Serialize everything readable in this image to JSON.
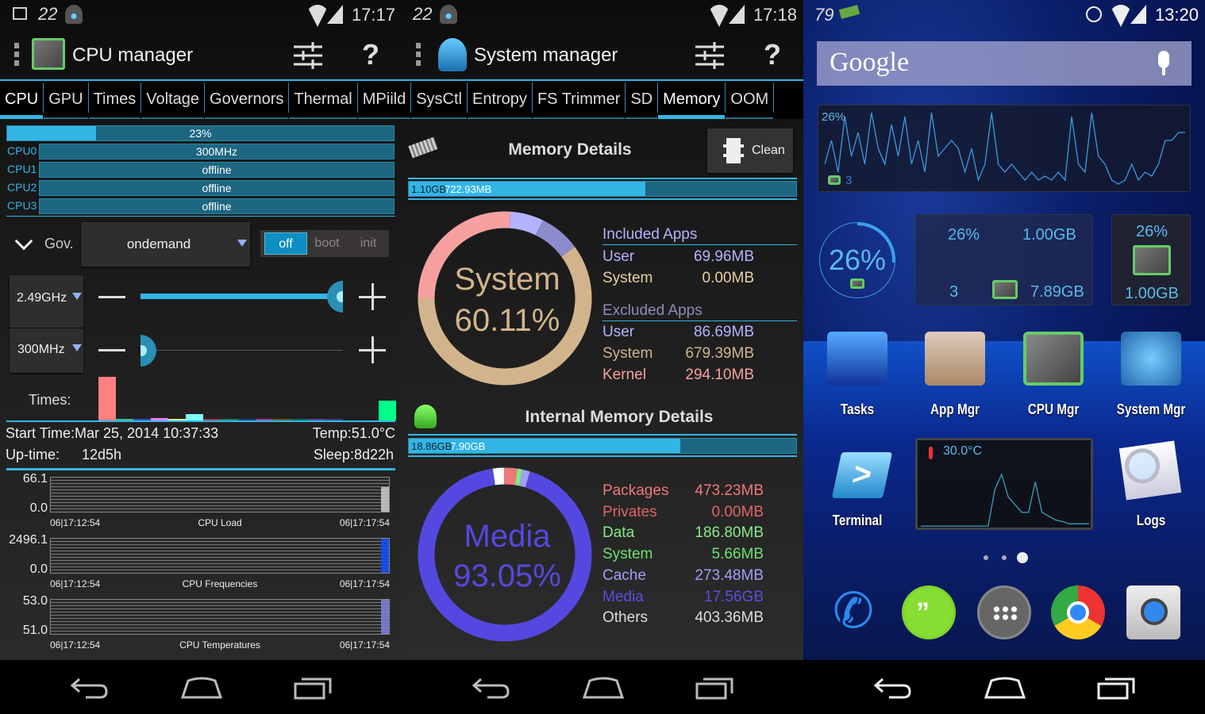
{
  "colors": {
    "accent": "#33b5e5",
    "bar_bg": "#1d6682",
    "kernel": "#f7a0a0",
    "system": "#d2b48c",
    "user_included": "#b3b3ff",
    "user_excluded": "#8c8ccc",
    "media": "#5548e0"
  },
  "cpu_manager": {
    "status": {
      "time": "17:17",
      "icons": [
        "picture-icon",
        "battery-22-icon",
        "eye-app-icon",
        "wifi-icon",
        "signal-icon"
      ],
      "battery": "22"
    },
    "title": "CPU manager",
    "actions": [
      "tune-icon",
      "help-icon"
    ],
    "help_label": "?",
    "total_load": {
      "label": "23%",
      "value": 23
    },
    "cores": [
      {
        "name": "CPU0",
        "label": "300MHz"
      },
      {
        "name": "CPU1",
        "label": "offline"
      },
      {
        "name": "CPU2",
        "label": "offline"
      },
      {
        "name": "CPU3",
        "label": "offline"
      }
    ],
    "gov_label": "Gov.",
    "governor": "ondemand",
    "apply_options": [
      "off",
      "boot",
      "init"
    ],
    "apply_selected": "off",
    "max_freq": {
      "value": "2.49GHz",
      "slider": 100
    },
    "min_freq": {
      "value": "300MHz",
      "slider": 0
    },
    "times_label": "Times:",
    "times_bars": [
      {
        "color": "#ff8080",
        "value": 100
      },
      {
        "color": "#40c080",
        "value": 2
      },
      {
        "color": "#3050c0",
        "value": 3
      },
      {
        "color": "#ff80ff",
        "value": 5
      },
      {
        "color": "#ffff80",
        "value": 4
      },
      {
        "color": "#80ffff",
        "value": 14
      },
      {
        "color": "#a04040",
        "value": 1
      },
      {
        "color": "#208060",
        "value": 1
      },
      {
        "color": "#204080",
        "value": 1
      },
      {
        "color": "#a040a0",
        "value": 1
      },
      {
        "color": "#606020",
        "value": 1
      },
      {
        "color": "#206060",
        "value": 1
      },
      {
        "color": "#6040a0",
        "value": 1
      },
      {
        "color": "#404080",
        "value": 1
      },
      {
        "color": "#00ff88",
        "value": 45
      }
    ],
    "start_time": "Start Time:Mar 25, 2014 10:37:33",
    "temp": "Temp:51.0°C",
    "uptime_label": "Up-time:",
    "uptime": "12d5h",
    "sleep": "Sleep:8d22h",
    "graphs": [
      {
        "title": "CPU Load",
        "max": "66.1",
        "min": "0.0",
        "start": "06|17:12:54",
        "end": "06|17:17:54",
        "color": "#cccccc"
      },
      {
        "title": "CPU Frequencies",
        "max": "2496.1",
        "min": "0.0",
        "start": "06|17:12:54",
        "end": "06|17:17:54",
        "color": "#1050ff"
      },
      {
        "title": "CPU Temperatures",
        "max": "53.0",
        "min": "51.0",
        "start": "06|17:12:54",
        "end": "06|17:17:54",
        "color": "#8080e0"
      }
    ]
  },
  "tabs": [
    {
      "label": "CPU",
      "selected": true
    },
    {
      "label": "GPU"
    },
    {
      "label": "Times"
    },
    {
      "label": "Voltage"
    },
    {
      "label": "Governors"
    },
    {
      "label": "Thermal"
    },
    {
      "label": "MPiild"
    },
    {
      "label": "SysCtl"
    },
    {
      "label": "Entropy"
    },
    {
      "label": "FS Trimmer"
    },
    {
      "label": "SD"
    },
    {
      "label": "Memory",
      "selected": true
    },
    {
      "label": "OOM"
    }
  ],
  "system_manager": {
    "status": {
      "time": "17:18",
      "battery": "22"
    },
    "title": "System manager",
    "help_label": "?",
    "memory": {
      "title": "Memory Details",
      "clean_label": "Clean",
      "used": "1.10GB",
      "free": "722.93MB",
      "used_fraction": 0.61,
      "donut_label": "System",
      "donut_value": "60.11%",
      "included_title": "Included Apps",
      "included": [
        {
          "label": "User",
          "value": "69.96MB",
          "color": "#b3b3ff"
        },
        {
          "label": "System",
          "value": "0.00MB",
          "color": "#e8cfa0"
        }
      ],
      "excluded_title": "Excluded Apps",
      "excluded": [
        {
          "label": "User",
          "value": "86.69MB",
          "color": "#b3b3ff"
        },
        {
          "label": "System",
          "value": "679.39MB",
          "color": "#d2b48c"
        },
        {
          "label": "Kernel",
          "value": "294.10MB",
          "color": "#f7a0a0"
        }
      ],
      "segments": [
        {
          "name": "Kernel",
          "mb": 294.1,
          "color": "#f7a0a0"
        },
        {
          "name": "User (included)",
          "mb": 69.96,
          "color": "#b3b3ff"
        },
        {
          "name": "User (excluded)",
          "mb": 86.69,
          "color": "#8c8ccc"
        },
        {
          "name": "System",
          "mb": 679.39,
          "color": "#d2b48c"
        }
      ]
    },
    "internal": {
      "title": "Internal Memory Details",
      "used": "18.86GB",
      "free": "7.90GB",
      "used_fraction": 0.7,
      "donut_label": "Media",
      "donut_value": "93.05%",
      "items": [
        {
          "label": "Packages",
          "value": "473.23MB",
          "color": "#f07878"
        },
        {
          "label": "Privates",
          "value": "0.00MB",
          "color": "#e06464"
        },
        {
          "label": "Data",
          "value": "186.80MB",
          "color": "#88e888"
        },
        {
          "label": "System",
          "value": "5.66MB",
          "color": "#70e070"
        },
        {
          "label": "Cache",
          "value": "273.48MB",
          "color": "#a0a0f5"
        },
        {
          "label": "Media",
          "value": "17.56GB",
          "color": "#5a4ee0"
        },
        {
          "label": "Others",
          "value": "403.36MB",
          "color": "#dddddd"
        }
      ],
      "segments": [
        {
          "name": "Others",
          "mb": 403.36,
          "color": "#ffffff"
        },
        {
          "name": "Packages",
          "mb": 473.23,
          "color": "#f07878"
        },
        {
          "name": "Data",
          "mb": 186.8,
          "color": "#88e888"
        },
        {
          "name": "Cache",
          "mb": 273.48,
          "color": "#a0a0f5"
        },
        {
          "name": "Media",
          "mb": 17981.44,
          "color": "#5548e0"
        }
      ]
    }
  },
  "home": {
    "status": {
      "left": "79",
      "time": "13:20"
    },
    "search_logo": "Google",
    "graph_widget": {
      "load": "26%",
      "cores": "3"
    },
    "circle_widget": {
      "load": "26%",
      "value": 26
    },
    "info_widget": {
      "load": "26%",
      "ram": "1.00GB",
      "cores": "3",
      "storage": "7.89GB"
    },
    "small_widget": {
      "load": "26%",
      "ram": "1.00GB"
    },
    "apps": [
      {
        "label": "Tasks",
        "icon": "tasks-monitor-icon"
      },
      {
        "label": "App Mgr",
        "icon": "toolbox-icon"
      },
      {
        "label": "CPU Mgr",
        "icon": "cpu-chip-icon"
      },
      {
        "label": "System Mgr",
        "icon": "android-system-icon"
      }
    ],
    "terminal_label": "Terminal",
    "logs_label": "Logs",
    "temp_widget": {
      "temp": "30.0°C"
    },
    "page_indicator": {
      "pages": 3,
      "current": 3
    },
    "dock": [
      "phone-icon",
      "hangouts-icon",
      "app-drawer-icon",
      "chrome-icon",
      "camera-icon"
    ]
  }
}
